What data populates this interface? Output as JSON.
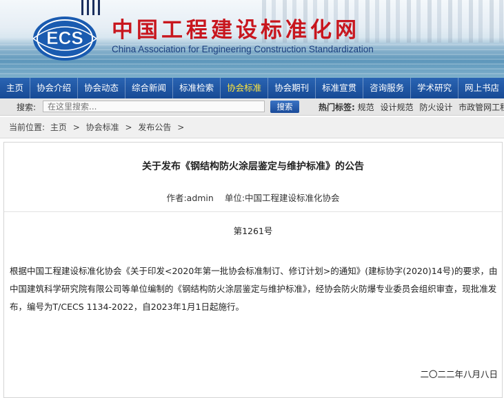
{
  "header": {
    "logo_text": "ECS",
    "title_cn": "中国工程建设标准化网",
    "title_en": "China Association for Engineering Construction Standardization"
  },
  "nav": {
    "items": [
      {
        "label": "主页",
        "active": false
      },
      {
        "label": "协会介绍",
        "active": false
      },
      {
        "label": "协会动态",
        "active": false
      },
      {
        "label": "综合新闻",
        "active": false
      },
      {
        "label": "标准检索",
        "active": false
      },
      {
        "label": "协会标准",
        "active": true
      },
      {
        "label": "协会期刊",
        "active": false
      },
      {
        "label": "标准宣贯",
        "active": false
      },
      {
        "label": "咨询服务",
        "active": false
      },
      {
        "label": "学术研究",
        "active": false
      },
      {
        "label": "网上书店",
        "active": false
      }
    ]
  },
  "search": {
    "label": "搜索:",
    "placeholder": "在这里搜索...",
    "button": "搜索",
    "hot_label": "热门标签:",
    "hot_tags": [
      "规范",
      "设计规范",
      "防火设计",
      "市政管网工程"
    ]
  },
  "breadcrumb": {
    "label": "当前位置:",
    "items": [
      "主页",
      "协会标准",
      "发布公告"
    ],
    "separator": ">"
  },
  "article": {
    "title": "关于发布《钢结构防火涂层鉴定与维护标准》的公告",
    "author": "作者:admin",
    "unit": "单位:中国工程建设标准化协会",
    "doc_no": "第1261号",
    "body": "根据中国工程建设标准化协会《关于印发<2020年第一批协会标准制订、修订计划>的通知》(建标协字(2020)14号)的要求，由中国建筑科学研究院有限公司等单位编制的《钢结构防火涂层鉴定与维护标准》，经协会防火防爆专业委员会组织审查，现批准发布，编号为T/CECS 1134-2022，自2023年1月1日起施行。",
    "date": "二〇二二年八月八日"
  },
  "colors": {
    "nav_bg": "#1f56a3",
    "nav_active": "#ffe53d",
    "title_red": "#c8161e",
    "en_blue": "#1b3e7e"
  }
}
